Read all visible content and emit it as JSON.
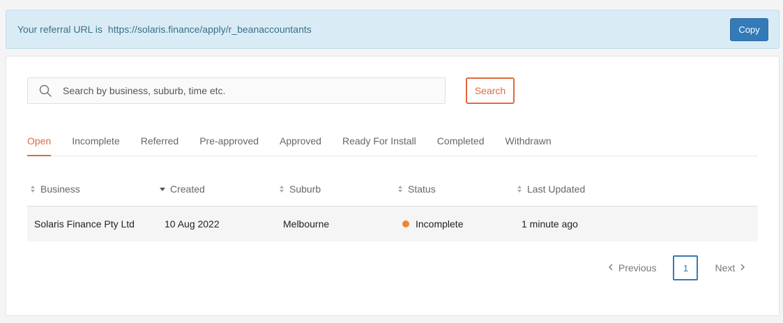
{
  "referral": {
    "prefix": "Your referral URL is",
    "url": "https://solaris.finance/apply/r_beanaccountants",
    "copy_label": "Copy"
  },
  "search": {
    "placeholder": "Search by business, suburb, time etc.",
    "value": "",
    "button_label": "Search"
  },
  "tabs": [
    {
      "label": "Open",
      "active": true
    },
    {
      "label": "Incomplete"
    },
    {
      "label": "Referred"
    },
    {
      "label": "Pre-approved"
    },
    {
      "label": "Approved"
    },
    {
      "label": "Ready For Install"
    },
    {
      "label": "Completed"
    },
    {
      "label": "Withdrawn"
    }
  ],
  "table": {
    "columns": [
      {
        "label": "Business",
        "sort": "both"
      },
      {
        "label": "Created",
        "sort": "desc"
      },
      {
        "label": "Suburb",
        "sort": "both"
      },
      {
        "label": "Status",
        "sort": "both"
      },
      {
        "label": "Last Updated",
        "sort": "both"
      }
    ],
    "rows": [
      {
        "business": "Solaris Finance Pty Ltd",
        "created": "10 Aug 2022",
        "suburb": "Melbourne",
        "status": "Incomplete",
        "status_color": "#f0852d",
        "last_updated": "1 minute ago"
      }
    ]
  },
  "pagination": {
    "previous_label": "Previous",
    "current_page": "1",
    "next_label": "Next",
    "prev_icon": "chevron-left-icon",
    "next_icon": "chevron-right-icon"
  },
  "colors": {
    "accent": "#e0693e",
    "primary": "#337ab7",
    "info_bg": "#d9ecf5"
  }
}
